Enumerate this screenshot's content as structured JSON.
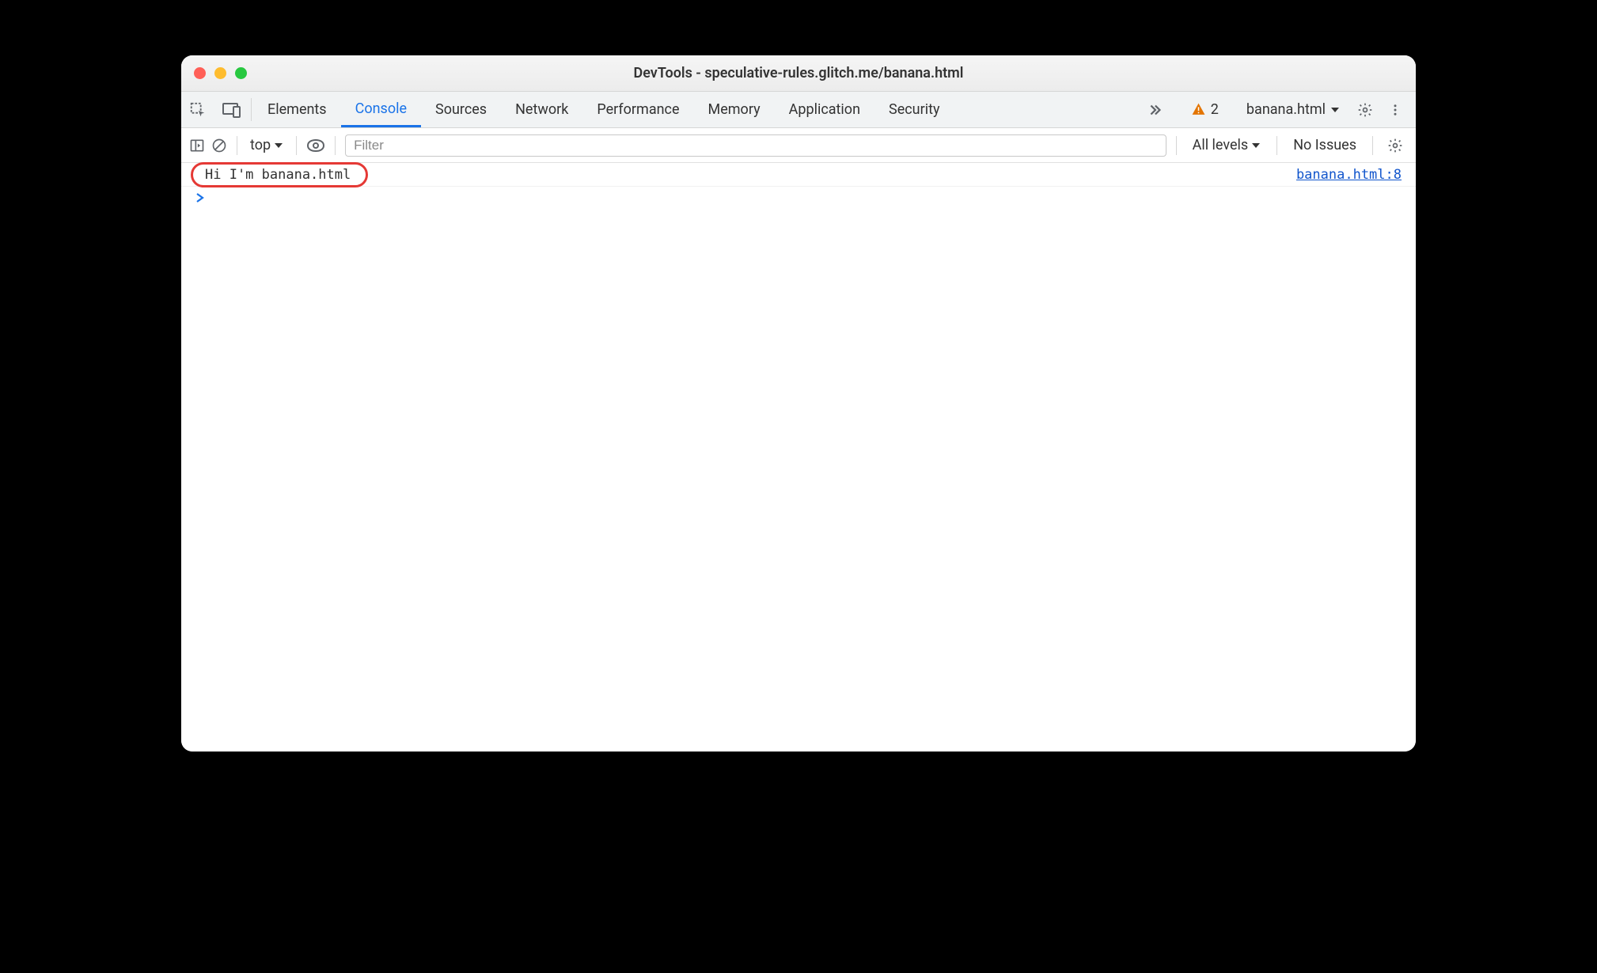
{
  "window": {
    "title": "DevTools - speculative-rules.glitch.me/banana.html"
  },
  "tabs": {
    "items": [
      "Elements",
      "Console",
      "Sources",
      "Network",
      "Performance",
      "Memory",
      "Application",
      "Security"
    ],
    "active": "Console"
  },
  "header_right": {
    "warnings_count": "2",
    "target_label": "banana.html"
  },
  "console_toolbar": {
    "context_label": "top",
    "filter_placeholder": "Filter",
    "levels_label": "All levels",
    "issues_label": "No Issues"
  },
  "console": {
    "logs": [
      {
        "message": "Hi I'm banana.html",
        "source": "banana.html:8"
      }
    ]
  }
}
